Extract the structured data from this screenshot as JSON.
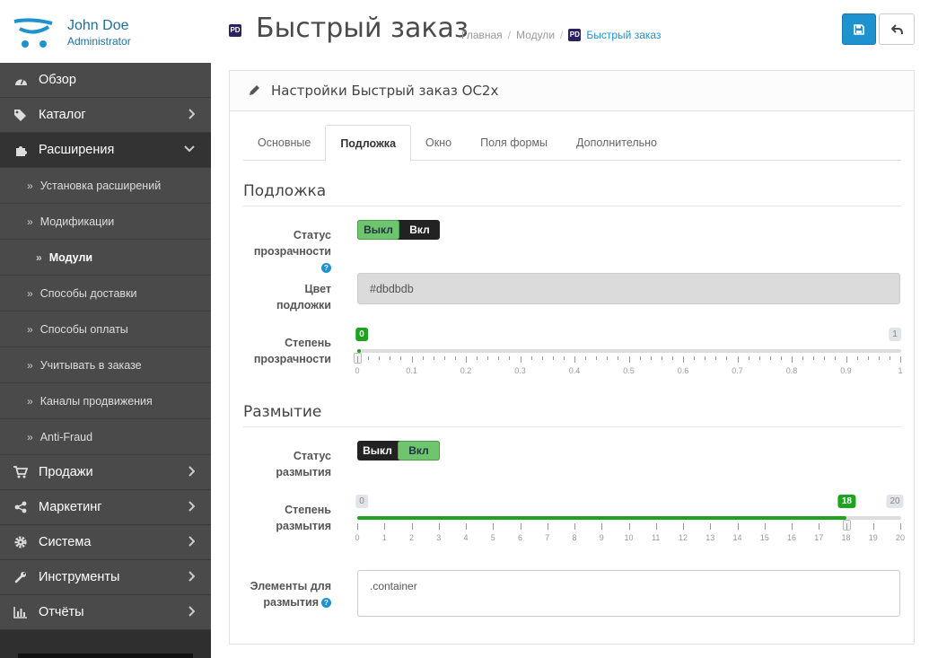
{
  "user": {
    "name": "John Doe",
    "role": "Administrator"
  },
  "sidebar": {
    "items": [
      {
        "label": "Обзор",
        "icon": "dashboard-icon"
      },
      {
        "label": "Каталог",
        "icon": "tags-icon"
      },
      {
        "label": "Расширения",
        "icon": "puzzle-icon"
      }
    ],
    "sub_items": [
      {
        "label": "Установка расширений"
      },
      {
        "label": "Модификации"
      },
      {
        "label": "Модули"
      },
      {
        "label": "Способы доставки"
      },
      {
        "label": "Способы оплаты"
      },
      {
        "label": "Учитывать в заказе"
      },
      {
        "label": "Каналы продвижения"
      },
      {
        "label": "Anti-Fraud"
      }
    ],
    "bottom_items": [
      {
        "label": "Продажи",
        "icon": "cart-icon"
      },
      {
        "label": "Маркетинг",
        "icon": "share-icon"
      },
      {
        "label": "Система",
        "icon": "gear-icon"
      },
      {
        "label": "Инструменты",
        "icon": "wrench-icon"
      },
      {
        "label": "Отчёты",
        "icon": "bar-chart-icon"
      }
    ]
  },
  "header": {
    "title": "Быстрый заказ",
    "icon_text": "PD",
    "breadcrumb": [
      "Главная",
      "Модули",
      "Быстрый заказ"
    ]
  },
  "panel": {
    "title": "Настройки Быстрый заказ OC2x",
    "tabs": [
      "Основные",
      "Подложка",
      "Окно",
      "Поля формы",
      "Дополнительно"
    ],
    "active_tab": "Подложка"
  },
  "overlay": {
    "legend": "Подложка",
    "status_label_1": "Статус",
    "status_label_2": "прозрачности",
    "status_off": "Выкл",
    "status_on": "Вкл",
    "status_value": "off",
    "color_label_1": "Цвет",
    "color_label_2": "подложки",
    "color_value": "#dbdbdb",
    "opacity_label_1": "Степень",
    "opacity_label_2": "прозрачности",
    "opacity": {
      "min": "0",
      "max": "1",
      "value": "0",
      "value_fraction": 0,
      "ticks": [
        "0",
        "0.1",
        "0.2",
        "0.3",
        "0.4",
        "0.5",
        "0.6",
        "0.7",
        "0.8",
        "0.9",
        "1"
      ]
    }
  },
  "blur": {
    "legend": "Размытие",
    "status_label_1": "Статус",
    "status_label_2": "размытия",
    "status_off": "Выкл",
    "status_on": "Вкл",
    "status_value": "on",
    "degree_label_1": "Степень",
    "degree_label_2": "размытия",
    "degree": {
      "min": "0",
      "max": "20",
      "value": "18",
      "value_fraction": 0.9,
      "ticks": [
        "0",
        "1",
        "2",
        "3",
        "4",
        "5",
        "6",
        "7",
        "8",
        "9",
        "10",
        "11",
        "12",
        "13",
        "14",
        "15",
        "16",
        "17",
        "18",
        "19",
        "20"
      ]
    },
    "elements_label_1": "Элементы для",
    "elements_label_2": "размытия",
    "elements_value": ".container"
  },
  "colors": {
    "primary": "#1e91cf",
    "success": "#1fa31f",
    "sidebar": "#2f2f2f"
  }
}
